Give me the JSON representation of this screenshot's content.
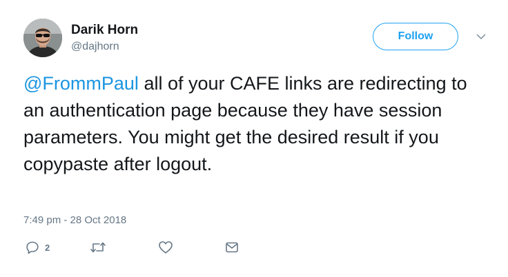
{
  "author": {
    "name": "Darik Horn",
    "handle": "@dajhorn"
  },
  "follow_label": "Follow",
  "tweet": {
    "mention": "@FrommPaul",
    "body": " all of your CAFE links are redirecting to an authentication page because they have session parameters.  You might get the desired result if you copypaste after logout."
  },
  "timestamp": "7:49 pm - 28 Oct 2018",
  "actions": {
    "reply_count": "2"
  },
  "colors": {
    "accent": "#1da1f2",
    "mention": "#1b95e0",
    "secondary_text": "#657786",
    "primary_text": "#14171a"
  },
  "icons": [
    "avatar-photo",
    "chevron-down-icon",
    "reply-icon",
    "retweet-icon",
    "like-heart-icon",
    "direct-message-icon"
  ]
}
